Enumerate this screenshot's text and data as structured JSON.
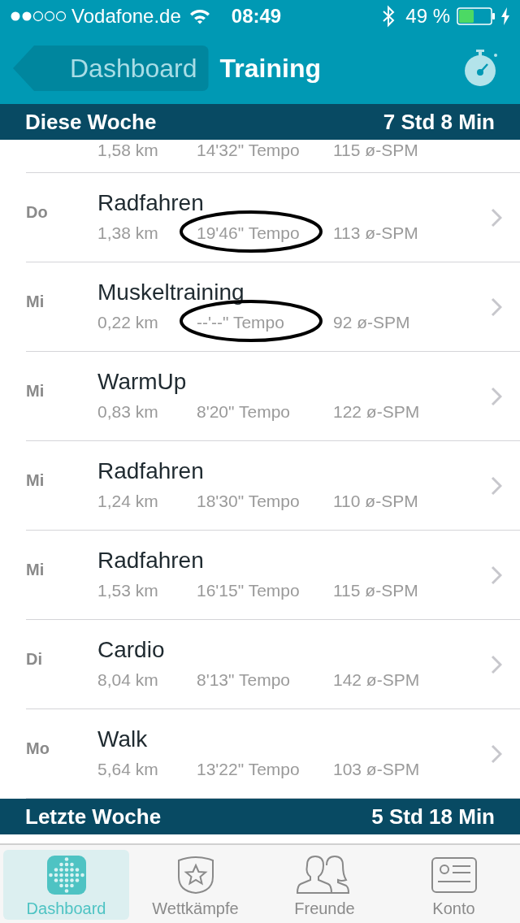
{
  "status_bar": {
    "carrier": "Vodafone.de",
    "time": "08:49",
    "battery_text": "49 %"
  },
  "nav": {
    "back": "Dashboard",
    "title": "Training"
  },
  "sections": [
    {
      "title": "Diese Woche",
      "total": "7 Std 8 Min",
      "rows": [
        {
          "kind": "partial",
          "distance": "1,58 km",
          "pace": "14'32\" Tempo",
          "spm": "115 ø-SPM",
          "circled": false
        },
        {
          "kind": "full",
          "day": "Do",
          "name": "Radfahren",
          "distance": "1,38 km",
          "pace": "19'46\" Tempo",
          "spm": "113 ø-SPM",
          "circled": true
        },
        {
          "kind": "full",
          "day": "Mi",
          "name": "Muskeltraining",
          "distance": "0,22 km",
          "pace": "--'--\" Tempo",
          "spm": "92 ø-SPM",
          "circled": true
        },
        {
          "kind": "full",
          "day": "Mi",
          "name": "WarmUp",
          "distance": "0,83 km",
          "pace": "8'20\" Tempo",
          "spm": "122 ø-SPM",
          "circled": false
        },
        {
          "kind": "full",
          "day": "Mi",
          "name": "Radfahren",
          "distance": "1,24 km",
          "pace": "18'30\" Tempo",
          "spm": "110 ø-SPM",
          "circled": false
        },
        {
          "kind": "full",
          "day": "Mi",
          "name": "Radfahren",
          "distance": "1,53 km",
          "pace": "16'15\" Tempo",
          "spm": "115 ø-SPM",
          "circled": false
        },
        {
          "kind": "full",
          "day": "Di",
          "name": "Cardio",
          "distance": "8,04 km",
          "pace": "8'13\" Tempo",
          "spm": "142 ø-SPM",
          "circled": false
        },
        {
          "kind": "full",
          "day": "Mo",
          "name": "Walk",
          "distance": "5,64 km",
          "pace": "13'22\" Tempo",
          "spm": "103 ø-SPM",
          "circled": false
        }
      ]
    },
    {
      "title": "Letzte Woche",
      "total": "5 Std 18 Min"
    }
  ],
  "tabs": [
    {
      "label": "Dashboard",
      "kind": "dashboard",
      "selected": true
    },
    {
      "label": "Wettkämpfe",
      "kind": "badge",
      "selected": false
    },
    {
      "label": "Freunde",
      "kind": "friends",
      "selected": false
    },
    {
      "label": "Konto",
      "kind": "account",
      "selected": false
    }
  ]
}
